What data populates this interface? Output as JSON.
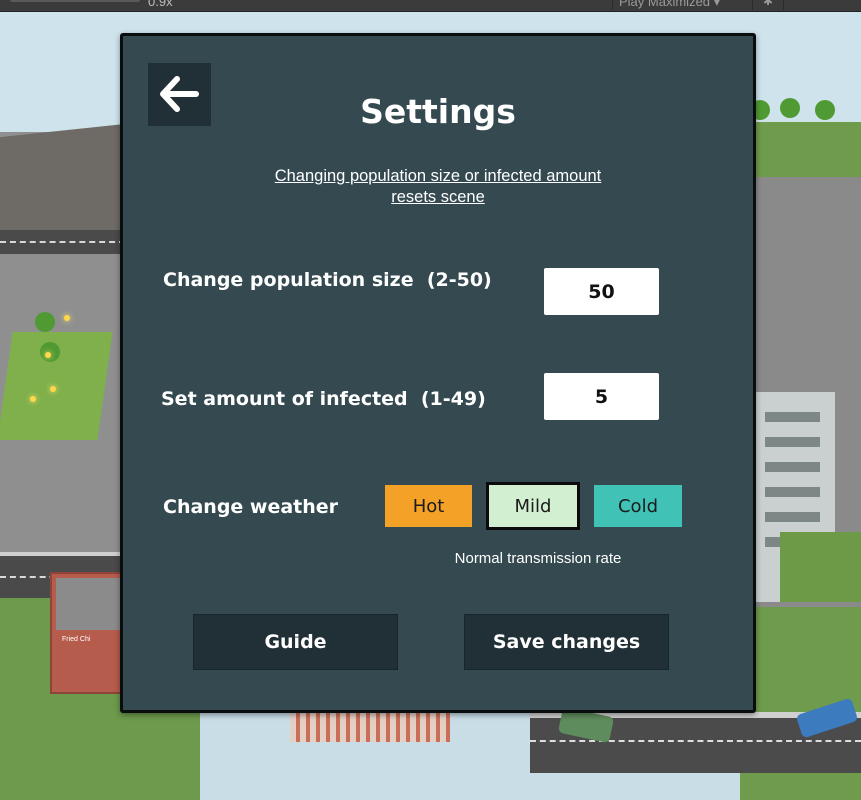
{
  "editor": {
    "scale_label": "0.9x",
    "play_mode_label": "Play Maximized",
    "play_mode_icon": "chevron-down-icon",
    "debug_icon": "bug-icon"
  },
  "scene": {
    "shop_sign": "Fried Chi"
  },
  "settings": {
    "back_icon": "arrow-left-icon",
    "title": "Settings",
    "notice_line1": "Changing population size or infected amount",
    "notice_line2": "resets scene",
    "population_label": "Change population size  (2-50)",
    "population_value": "50",
    "infected_label": "Set amount of infected  (1-49)",
    "infected_value": "5",
    "weather_label": "Change weather",
    "weather_options": [
      {
        "label": "Hot",
        "color": "#f4a227"
      },
      {
        "label": "Mild",
        "color": "#d2f0d1",
        "selected": true
      },
      {
        "label": "Cold",
        "color": "#40c2b6"
      }
    ],
    "weather_description": "Normal transmission rate",
    "guide_button": "Guide",
    "save_button": "Save changes"
  },
  "colors": {
    "panel_bg": "#354a50",
    "button_dark": "#213036",
    "text": "#ffffff"
  }
}
